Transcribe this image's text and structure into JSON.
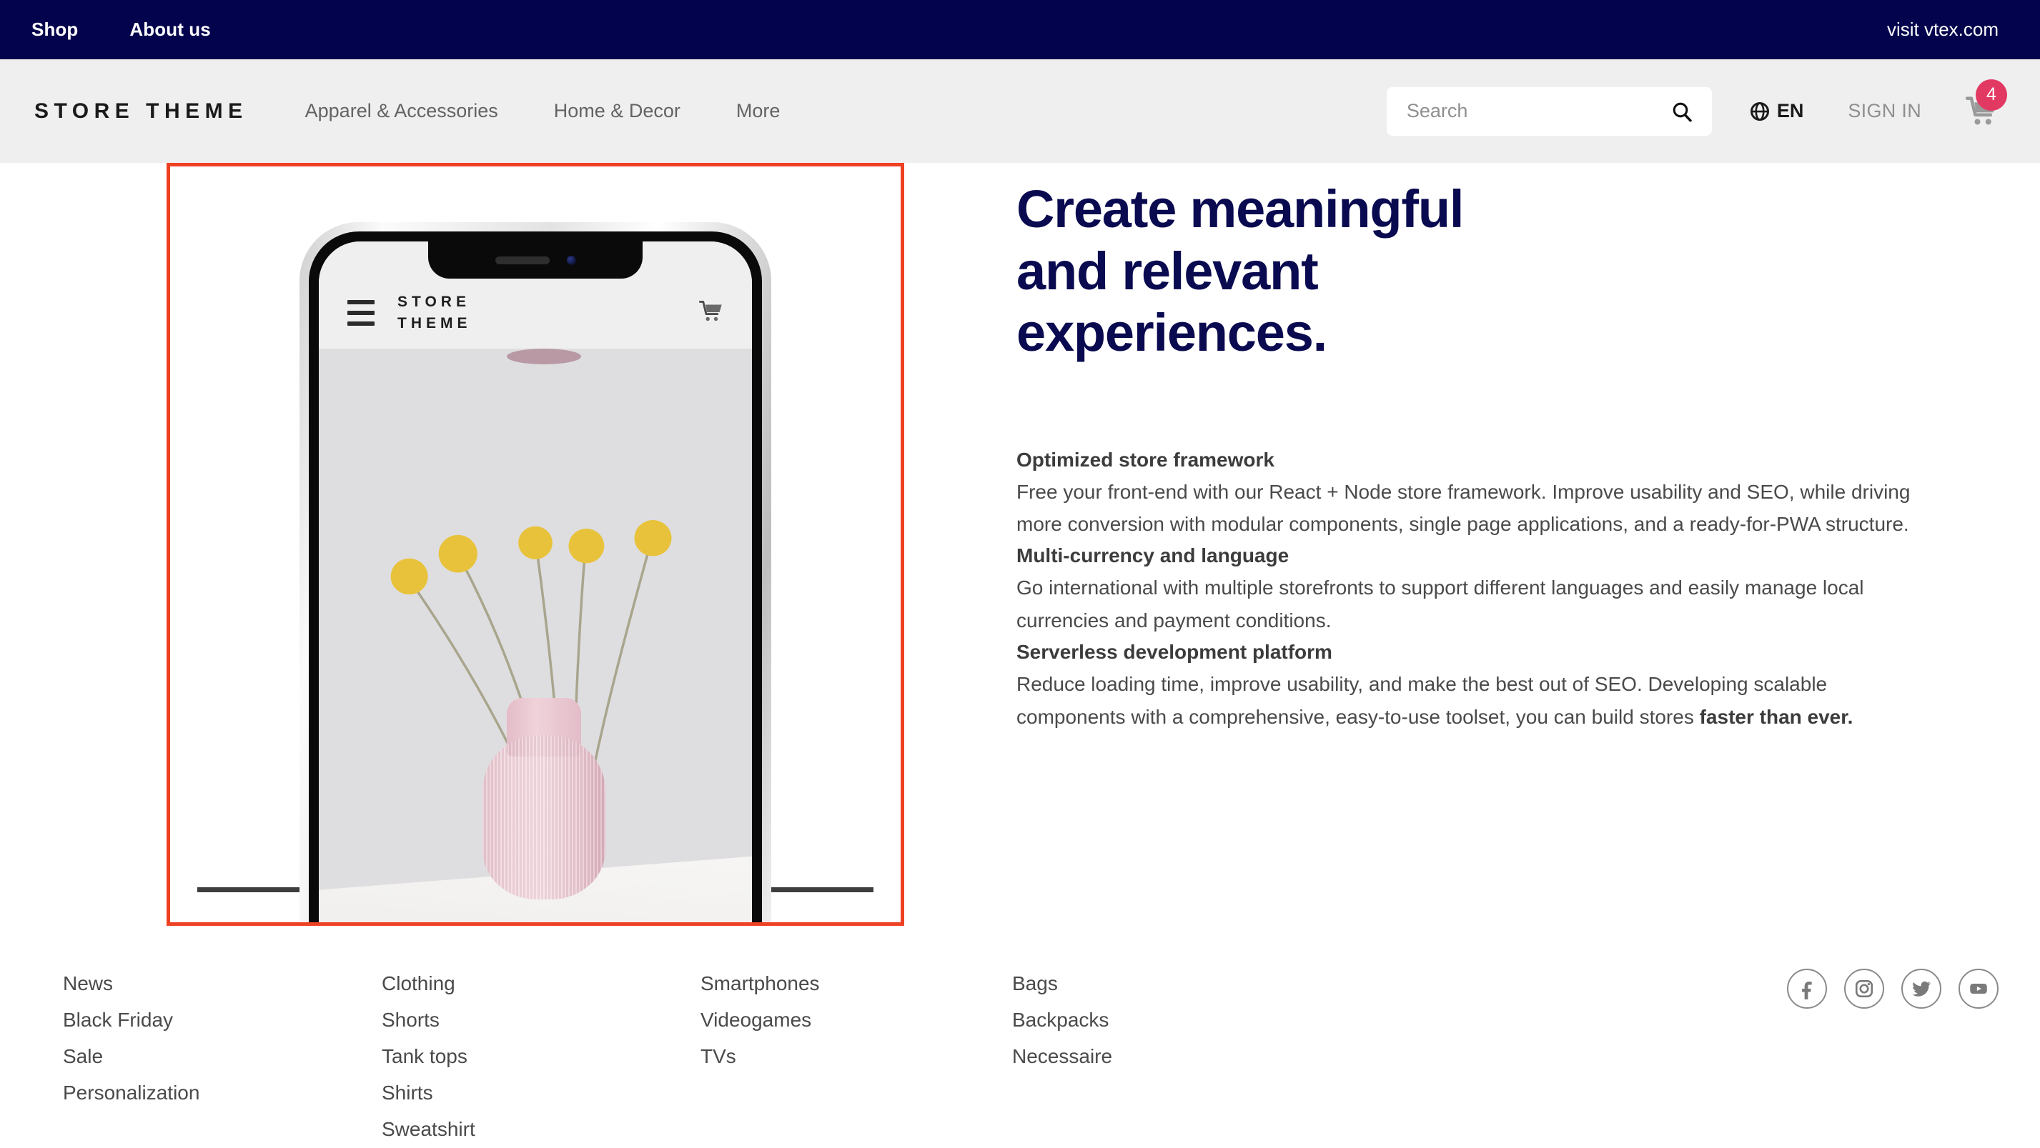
{
  "topbar": {
    "links": [
      {
        "label": "Shop"
      },
      {
        "label": "About us"
      }
    ],
    "visit_label": "visit vtex.com",
    "background": "#02024d"
  },
  "header": {
    "brand": "STORE THEME",
    "nav": [
      {
        "label": "Apparel & Accessories"
      },
      {
        "label": "Home & Decor"
      },
      {
        "label": "More"
      }
    ],
    "search": {
      "placeholder": "Search",
      "value": "",
      "icon": "search-icon"
    },
    "language": {
      "icon": "globe-icon",
      "label": "EN"
    },
    "signin_label": "SIGN IN",
    "cart": {
      "icon": "shopping-cart-icon",
      "count": "4",
      "badge_color": "#e23963"
    },
    "background": "#efefef"
  },
  "hero": {
    "highlight_color": "#ef4123",
    "image": {
      "alt": "Smartphone mockup displaying Store Theme mobile storefront with pink ribbed vase and yellow billy ball flowers",
      "phone_brand": "STORE THEME",
      "phone_menu_icon": "hamburger-menu-icon",
      "phone_cart_icon": "shopping-cart-icon"
    },
    "headline_lines": [
      "Create meaningful",
      "and relevant",
      "experiences."
    ],
    "headline_color": "#0a0a50",
    "features": [
      {
        "title": "Optimized store framework",
        "body": "Free your front-end with our React + Node store framework. Improve usability and SEO, while driving more conversion with modular components, single page applications, and a ready-for-PWA structure."
      },
      {
        "title": "Multi-currency and language",
        "body": "Go international with multiple storefronts to support different languages and easily manage local currencies and payment conditions."
      },
      {
        "title": "Serverless development platform",
        "body": "Reduce loading time, improve usability, and make the best out of SEO. Developing scalable components with a comprehensive, easy-to-use toolset, you can build stores ",
        "body_bold": "faster than ever."
      }
    ]
  },
  "footer": {
    "columns": [
      {
        "links": [
          {
            "label": "News"
          },
          {
            "label": "Black Friday"
          },
          {
            "label": "Sale"
          },
          {
            "label": "Personalization"
          }
        ]
      },
      {
        "links": [
          {
            "label": "Clothing"
          },
          {
            "label": "Shorts"
          },
          {
            "label": "Tank tops"
          },
          {
            "label": "Shirts"
          },
          {
            "label": "Sweatshirt"
          }
        ]
      },
      {
        "links": [
          {
            "label": "Smartphones"
          },
          {
            "label": "Videogames"
          },
          {
            "label": "TVs"
          }
        ]
      },
      {
        "links": [
          {
            "label": "Bags"
          },
          {
            "label": "Backpacks"
          },
          {
            "label": "Necessaire"
          }
        ]
      }
    ],
    "socials": [
      {
        "name": "facebook-icon"
      },
      {
        "name": "instagram-icon"
      },
      {
        "name": "twitter-icon"
      },
      {
        "name": "youtube-icon"
      }
    ]
  }
}
